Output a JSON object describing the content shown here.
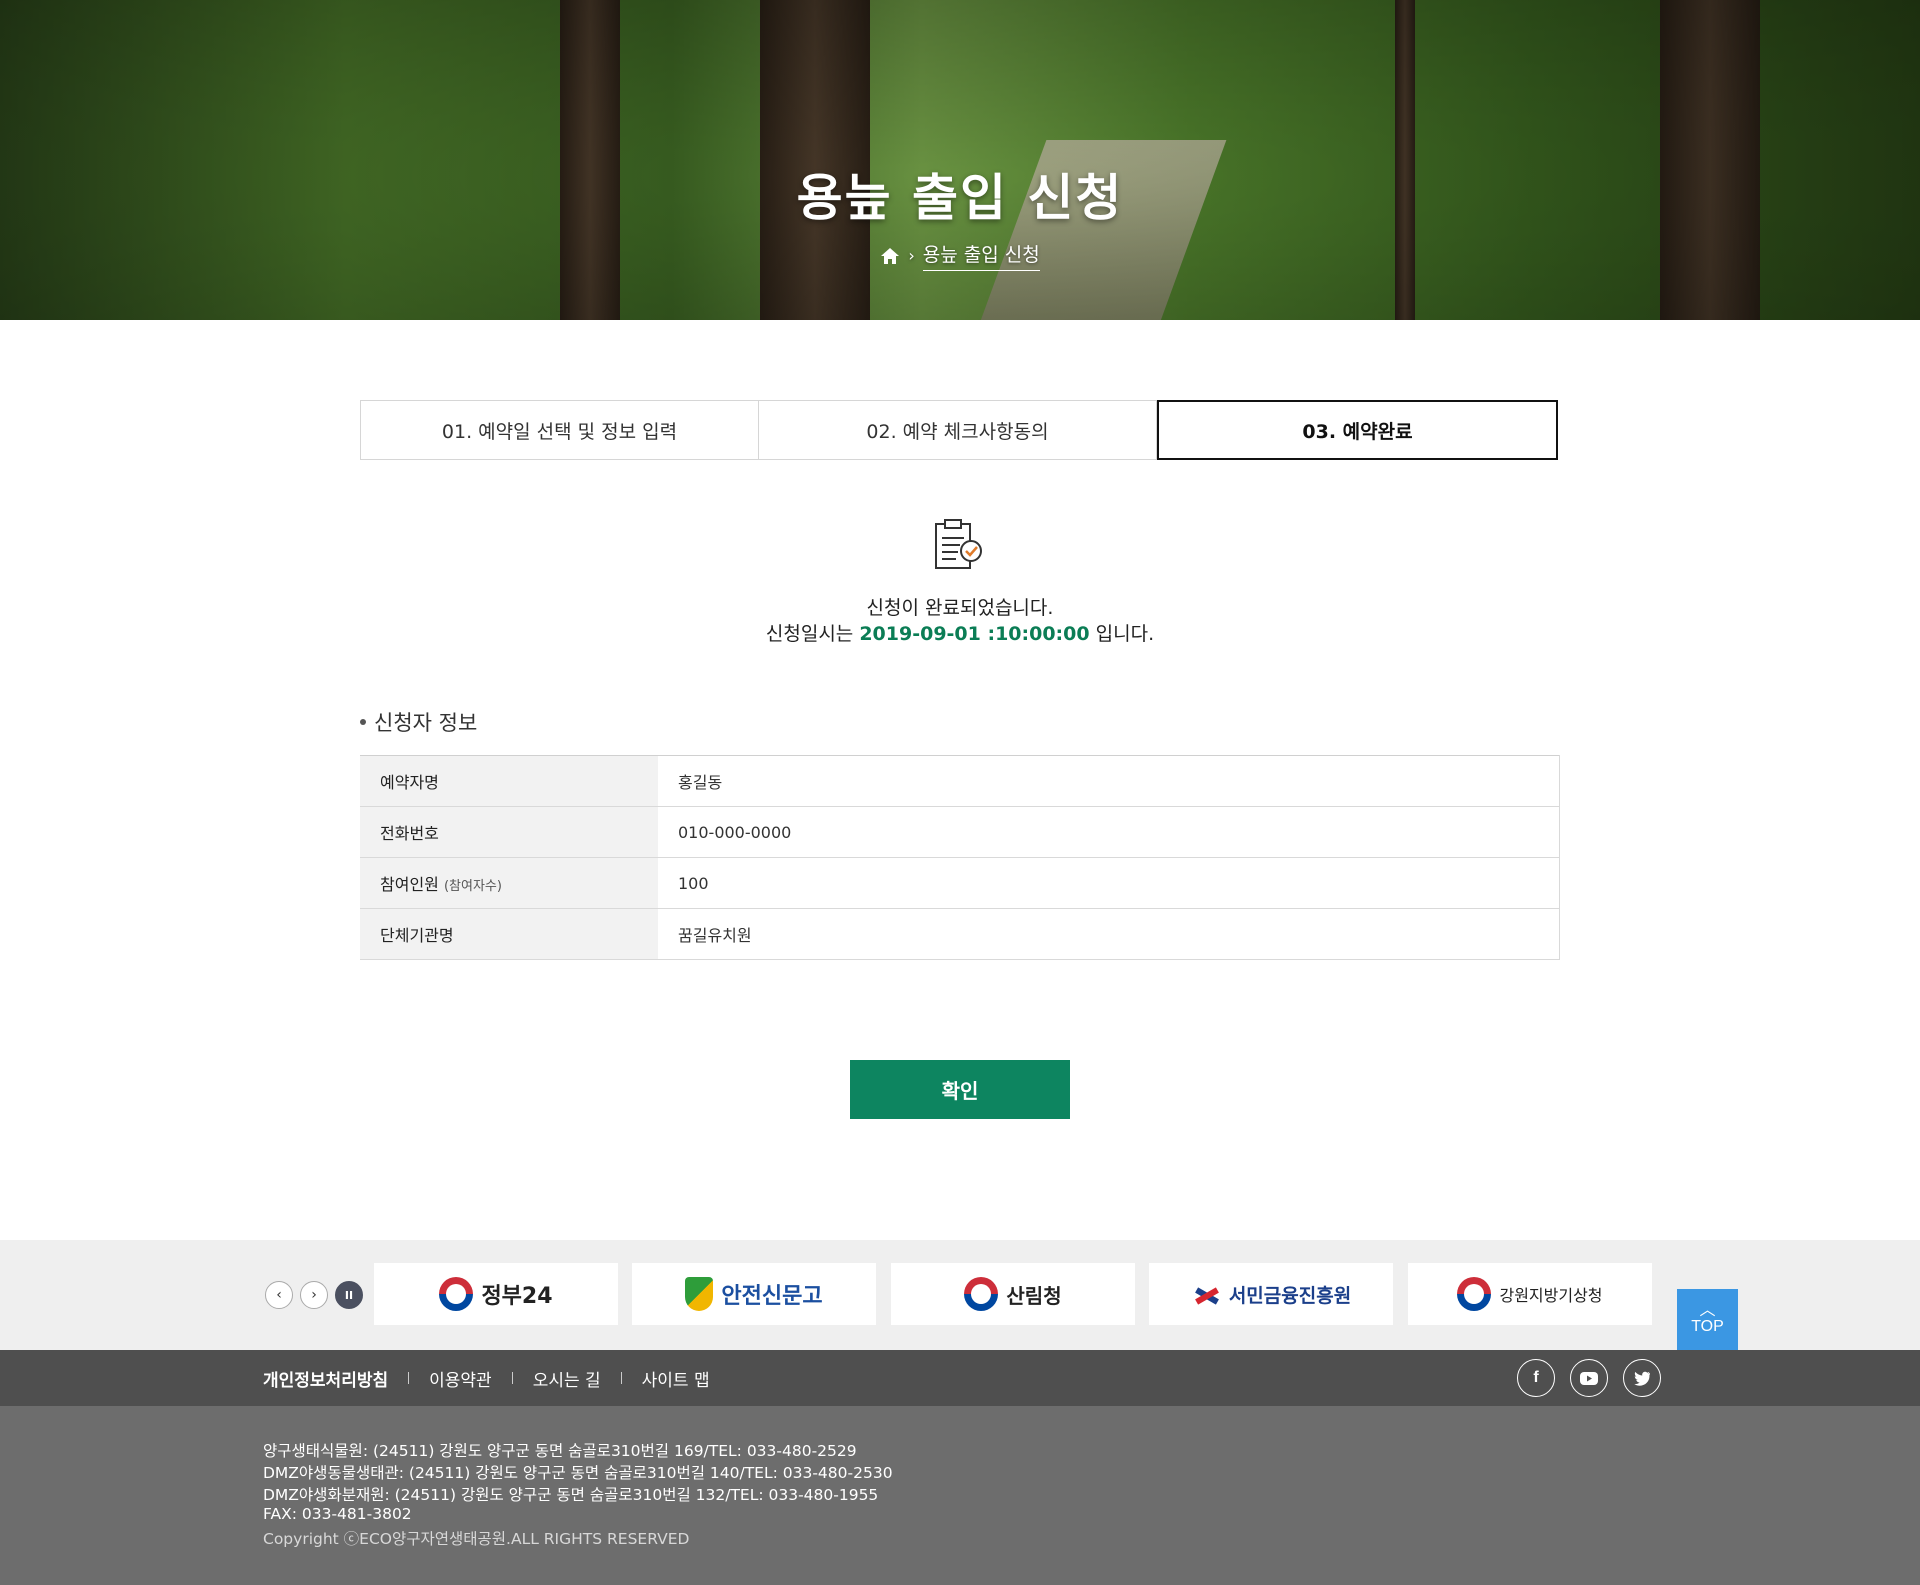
{
  "hero": {
    "title": "용늪 출입 신청",
    "breadcrumb": "용늪 출입 신청"
  },
  "steps": [
    {
      "label": "01. 예약일 선택 및 정보 입력",
      "active": false
    },
    {
      "label": "02. 예약 체크사항동의",
      "active": false
    },
    {
      "label": "03. 예약완료",
      "active": true
    }
  ],
  "complete": {
    "line1": "신청이 완료되었습니다.",
    "line2_prefix": "신청일시는",
    "datetime": "2019-09-01 :10:00:00",
    "line2_suffix": "입니다."
  },
  "applicant": {
    "section_title": "신청자 정보",
    "rows": [
      {
        "label": "예약자명",
        "note": "",
        "value": "홍길동"
      },
      {
        "label": "전화번호",
        "note": "",
        "value": "010-000-0000"
      },
      {
        "label": "참여인원",
        "note": "(참여자수)",
        "value": "100"
      },
      {
        "label": "단체기관명",
        "note": "",
        "value": "꿈길유치원"
      }
    ]
  },
  "confirm_label": "확인",
  "banners": [
    {
      "label": "정부24",
      "icon": "taegeuk-icon"
    },
    {
      "label": "안전신문고",
      "icon": "shield-icon"
    },
    {
      "label": "산림청",
      "icon": "taegeuk-icon"
    },
    {
      "label": "서민금융진흥원",
      "icon": "cross-mark-icon"
    },
    {
      "label": "강원지방기상청",
      "icon": "taegeuk-icon"
    }
  ],
  "top_label": "TOP",
  "footer_links": [
    "개인정보처리방침",
    "이용약관",
    "오시는 길",
    "사이트 맵"
  ],
  "sns": [
    "facebook-icon",
    "youtube-icon",
    "twitter-icon"
  ],
  "footer_addresses": [
    "양구생태식물원: (24511) 강원도 양구군 동면 숨골로310번길 169/TEL: 033-480-2529",
    "DMZ야생동물생태관: (24511) 강원도 양구군 동면 숨골로310번길 140/TEL: 033-480-2530",
    "DMZ야생화분재원: (24511) 강원도 양구군 동면 숨골로310번길 132/TEL: 033-480-1955",
    "FAX: 033-481-3802"
  ],
  "copyright": "Copyright ⓒECO양구자연생태공원.ALL RIGHTS RESERVED",
  "colors": {
    "accent": "#0d8560",
    "top_button": "#3b97e3",
    "footer_nav": "#4f4f4f",
    "footer": "#6d6d6d"
  }
}
